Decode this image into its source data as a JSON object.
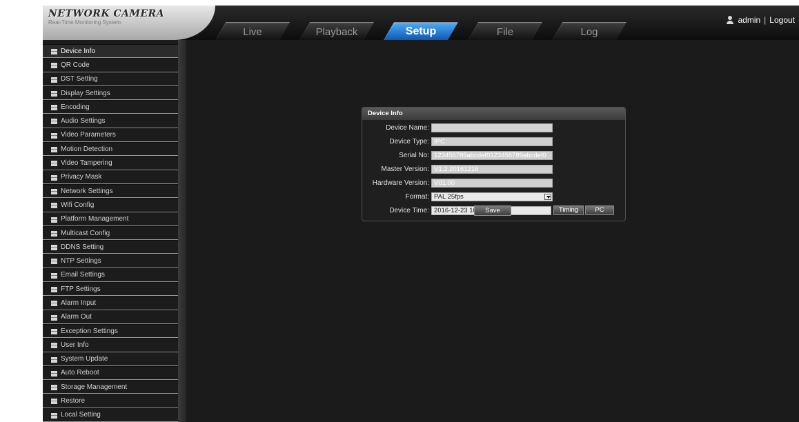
{
  "header": {
    "logo_title": "NETWORK CAMERA",
    "logo_subtitle": "Real-Time Monitoring System",
    "tabs": [
      {
        "label": "Live"
      },
      {
        "label": "Playback"
      },
      {
        "label": "Setup",
        "active": true
      },
      {
        "label": "File"
      },
      {
        "label": "Log"
      }
    ],
    "username": "admin",
    "separator": "|",
    "logout_label": "Logout"
  },
  "sidebar": {
    "active_item": "Device Info",
    "items": [
      {
        "label": "Device Info"
      },
      {
        "label": "QR Code"
      },
      {
        "label": "DST Setting"
      },
      {
        "label": "Display Settings"
      },
      {
        "label": "Encoding"
      },
      {
        "label": "Audio Settings"
      },
      {
        "label": "Video Parameters"
      },
      {
        "label": "Motion Detection"
      },
      {
        "label": "Video Tampering"
      },
      {
        "label": "Privacy Mask"
      },
      {
        "label": "Network Settings"
      },
      {
        "label": "Wifi Config"
      },
      {
        "label": "Platform Management"
      },
      {
        "label": "Multicast Config"
      },
      {
        "label": "DDNS Setting"
      },
      {
        "label": "NTP Settings"
      },
      {
        "label": "Email Settings"
      },
      {
        "label": "FTP Settings"
      },
      {
        "label": "Alarm Input"
      },
      {
        "label": "Alarm Out"
      },
      {
        "label": "Exception Settings"
      },
      {
        "label": "User Info"
      },
      {
        "label": "System Update"
      },
      {
        "label": "Auto Reboot"
      },
      {
        "label": "Storage Management"
      },
      {
        "label": "Restore"
      },
      {
        "label": "Local Setting"
      }
    ]
  },
  "panel": {
    "title": "Device Info",
    "fields": {
      "device_name": {
        "label": "Device Name:",
        "value": ""
      },
      "device_type": {
        "label": "Device Type:",
        "value": "IPC"
      },
      "serial_no": {
        "label": "Serial No:",
        "value": "123456789abcdef0123456789abcdef0"
      },
      "master_version": {
        "label": "Master Version:",
        "value": "V1.2.20161216"
      },
      "hardware_version": {
        "label": "Hardware Version:",
        "value": "V01.00"
      },
      "format": {
        "label": "Format:",
        "value": "PAL 25fps"
      },
      "device_time": {
        "label": "Device Time:",
        "value": "2016-12-23 10:6:22"
      }
    },
    "timing_label": "Timing",
    "pc_label": "PC",
    "save_label": "Save"
  },
  "colors": {
    "active_tab": "#1a6fd0",
    "background": "#1b1b1b",
    "sidebar": "#1c1c1c"
  }
}
